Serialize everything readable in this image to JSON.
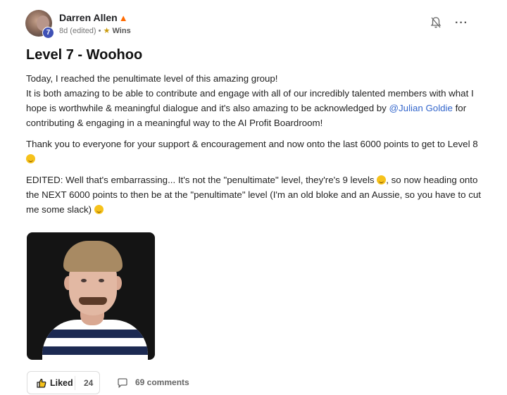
{
  "post": {
    "author": "Darren Allen",
    "author_level": "7",
    "time": "8d (edited)",
    "separator": "•",
    "category": "Wins",
    "title": "Level 7 - Woohoo",
    "p1_line1": "Today, I reached the penultimate level of this amazing group!",
    "p1_line2": "It is both amazing to be able to contribute and engage with all of our incredibly talented members with what I hope is worthwhile & meaningful dialogue and it's also amazing to be acknowledged by ",
    "mention": "@Julian Goldie",
    "p1_line3": " for contributing & engaging in a meaningful way to the AI Profit Boardroom!",
    "p2": "Thank you to everyone for your support & encouragement and now onto the last 6000 points to get to Level 8 ",
    "p3_a": "EDITED: Well that's embarrassing... It's not the \"penultimate\" level, they're's 9 levels ",
    "p3_b": ", so now heading onto the NEXT 6000 points to then be at the \"penultimate\" level (I'm an old bloke and an Aussie, so you have to cut me some slack) "
  },
  "actions": {
    "liked_label": "Liked",
    "like_count": "24",
    "comments_label": "69 comments"
  },
  "icons": {
    "fire": "fire-icon",
    "trophy": "trophy-icon",
    "bell": "bell-muted-icon",
    "more": "more-dots-icon",
    "thumb": "thumbs-up-icon",
    "comment": "comment-bubble-icon"
  },
  "colors": {
    "mention": "#3366cc",
    "level_badge": "#3f51b5"
  }
}
